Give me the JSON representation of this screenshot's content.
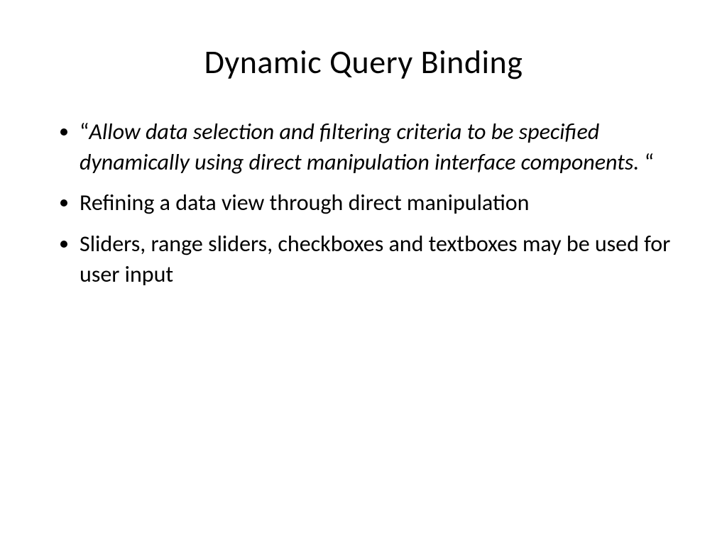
{
  "slide": {
    "title": "Dynamic Query Binding",
    "bullets": [
      {
        "quote_open": "“",
        "quoted_text": "Allow data selection and filtering criteria to be specified dynamically using direct manipulation interface components. ",
        "quote_close": "“",
        "is_quote": true
      },
      {
        "text": "Refining a data view through direct manipulation",
        "is_quote": false
      },
      {
        "text": "Sliders, range sliders, checkboxes and textboxes may be used for user input",
        "is_quote": false
      }
    ]
  }
}
